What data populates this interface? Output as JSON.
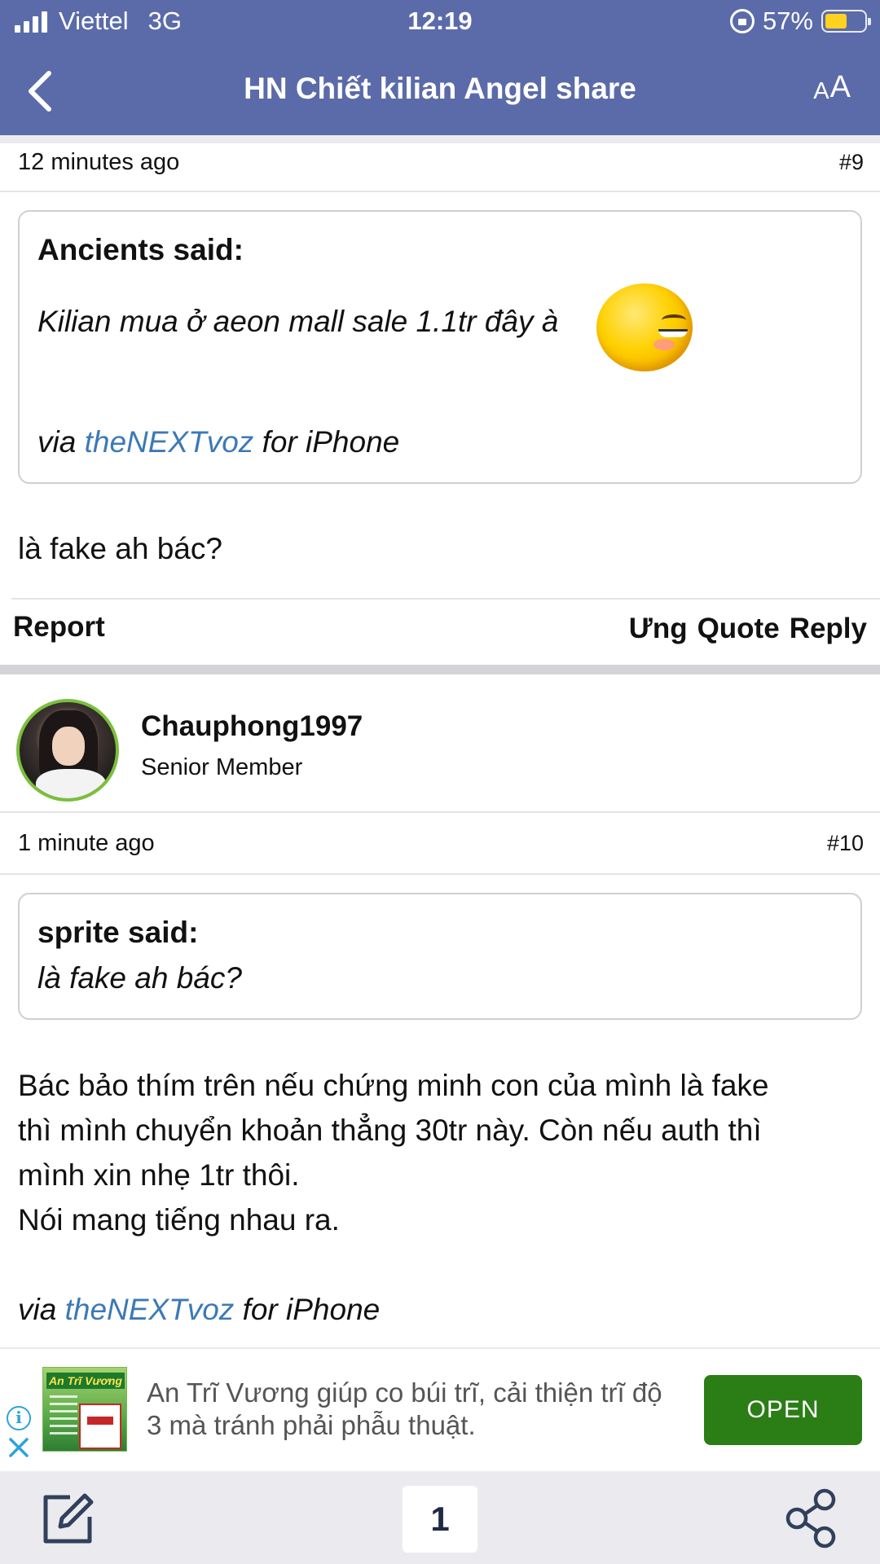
{
  "status_bar": {
    "carrier": "Viettel",
    "network": "3G",
    "time": "12:19",
    "battery_percent": "57%",
    "battery_level": 0.57
  },
  "header": {
    "title": "HN Chiết kilian Angel share",
    "font_size_button": {
      "small": "A",
      "large": "A"
    },
    "accent_color": "#5b6ba9"
  },
  "post9": {
    "time": "12 minutes ago",
    "number": "#9",
    "quote": {
      "author": "Ancients said:",
      "text": "Kilian mua ở aeon mall sale 1.1tr đây à",
      "emoji": "blushing-wink-emoji",
      "via_prefix": "via",
      "via_link": "theNEXTvoz",
      "via_suffix": "for iPhone"
    },
    "body": "là fake ah bác?",
    "actions": {
      "report": "Report",
      "like": "Ưng",
      "quote": "Quote",
      "reply": "Reply"
    }
  },
  "post10": {
    "user": {
      "name": "Chauphong1997",
      "rank": "Senior Member"
    },
    "time": "1 minute ago",
    "number": "#10",
    "quote": {
      "author": "sprite said:",
      "text": "là fake ah bác?"
    },
    "body_lines": [
      "Bác bảo thím trên nếu chứng minh con của mình là fake",
      "thì mình chuyển khoản thẳng 30tr này. Còn nếu auth thì",
      "mình xin nhẹ 1tr thôi.",
      "Nói mang tiếng nhau ra."
    ],
    "via_prefix": "via",
    "via_link": "theNEXTvoz",
    "via_suffix": "for iPhone"
  },
  "ad": {
    "brand": "An Trĩ Vương",
    "text": "An Trĩ Vương giúp co búi trĩ, cải thiện trĩ độ 3 mà tránh phải phẫu thuật.",
    "open_label": "OPEN",
    "open_color": "#2b7d16"
  },
  "toolbar": {
    "page_number": "1"
  }
}
